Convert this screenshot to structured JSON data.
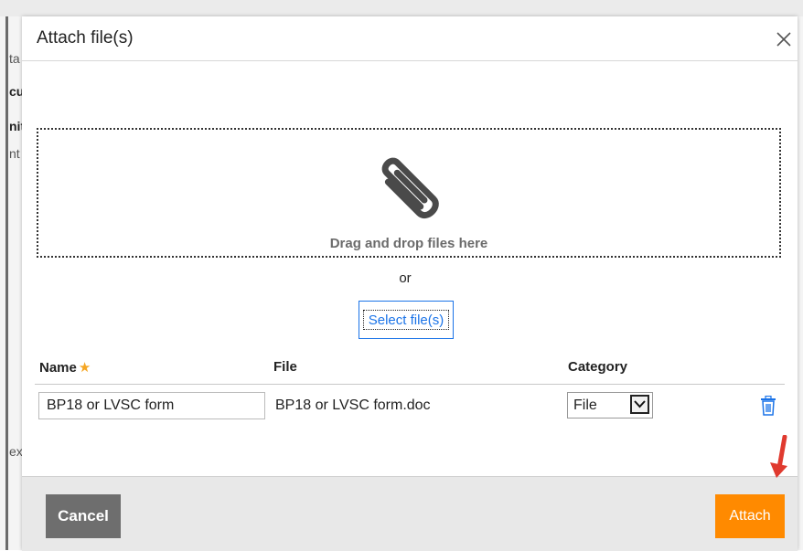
{
  "background": {
    "fragments": [
      "ta",
      "cu",
      "nit",
      "nt",
      "ex"
    ]
  },
  "dialog": {
    "title": "Attach file(s)",
    "close_icon": "close-icon"
  },
  "dropzone": {
    "icon": "paperclip-icon",
    "text": "Drag and drop files here"
  },
  "or_text": "or",
  "select_files_label": "Select file(s)",
  "table": {
    "headers": {
      "name": "Name",
      "required_mark": "★",
      "file": "File",
      "category": "Category"
    },
    "rows": [
      {
        "name_value": "BP18 or LVSC form",
        "file": "BP18 or LVSC form.doc",
        "category": "File",
        "delete_icon": "trash-icon"
      }
    ]
  },
  "footer": {
    "cancel_label": "Cancel",
    "attach_label": "Attach"
  },
  "colors": {
    "attach": "#ff8a00",
    "cancel": "#6e6e6e",
    "link": "#1a73e8",
    "required_star": "#f5a623",
    "annotation_arrow": "#e03a2f"
  }
}
